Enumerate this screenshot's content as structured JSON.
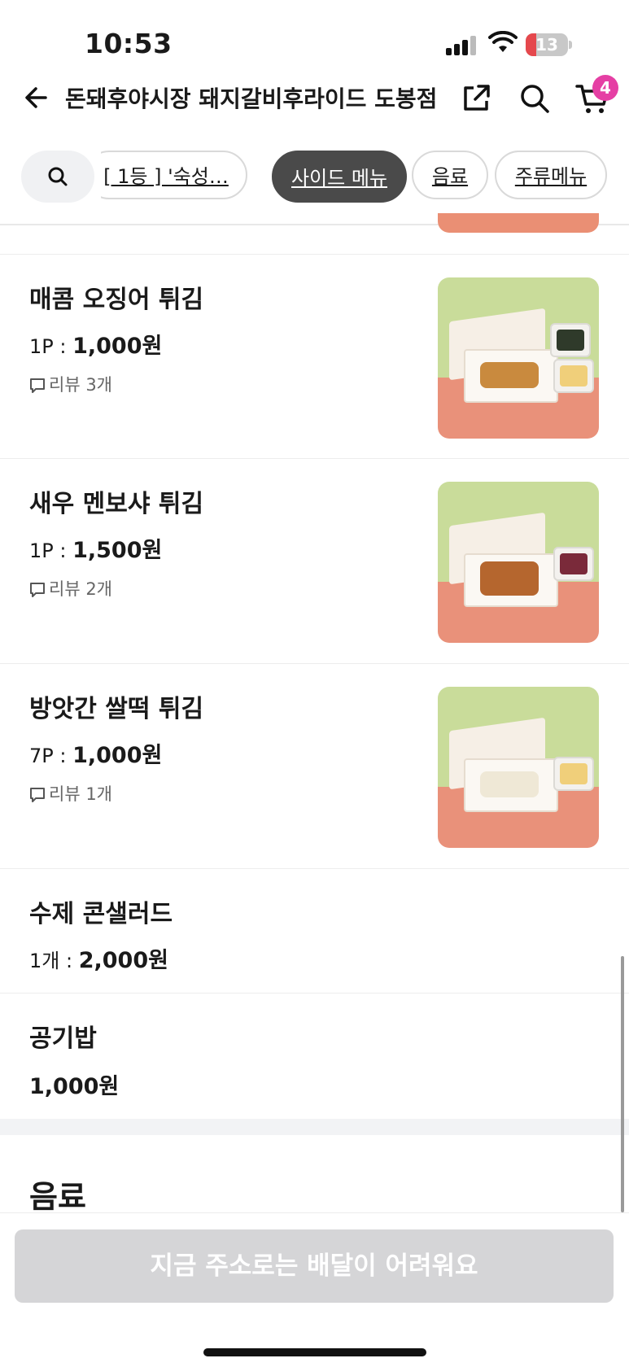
{
  "status_bar": {
    "time": "10:53",
    "battery": "13"
  },
  "header": {
    "store_name": "돈돼후야시장 돼지갈비후라이드 도봉점",
    "cart_count": "4"
  },
  "tabs": [
    {
      "label": "[ 1등 ] '숙성…"
    },
    {
      "label": "사이드 메뉴",
      "active": true
    },
    {
      "label": "음료"
    },
    {
      "label": "주류메뉴"
    }
  ],
  "menu_items": [
    {
      "name": "매콤 오징어 튀김",
      "unit": "1P : ",
      "price": "1,000원",
      "review": "리뷰 3개"
    },
    {
      "name": "새우 멘보샤 튀김",
      "unit": "1P : ",
      "price": "1,500원",
      "review": "리뷰 2개"
    },
    {
      "name": "방앗간 쌀떡 튀김",
      "unit": "7P : ",
      "price": "1,000원",
      "review": "리뷰 1개"
    },
    {
      "name": "수제 콘샐러드",
      "unit": "1개 : ",
      "price": "2,000원"
    },
    {
      "name": "공기밥",
      "price": "1,000원"
    }
  ],
  "next_section": {
    "title": "음료"
  },
  "bottom": {
    "order_button": "지금 주소로는 배달이 어려워요"
  },
  "colors": {
    "accent_badge": "#e53fa4",
    "active_tab": "#4a4a4a",
    "disabled_button": "#d5d5d7"
  }
}
